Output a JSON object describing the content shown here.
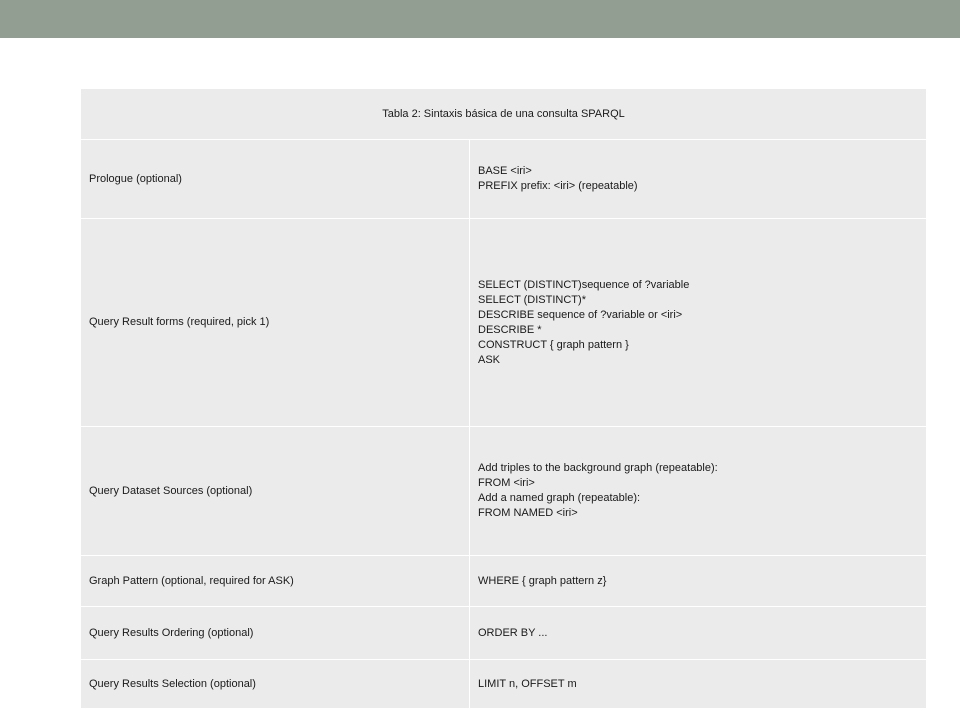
{
  "table": {
    "caption": "Tabla 2: Sintaxis básica de una consulta SPARQL",
    "rows": [
      {
        "label": "Prologue (optional)",
        "lines": [
          "BASE <iri>",
          "PREFIX prefix: <iri> (repeatable)"
        ]
      },
      {
        "label": "Query Result forms (required, pick 1)",
        "lines": [
          "SELECT (DISTINCT)sequence of ?variable",
          "SELECT (DISTINCT)*",
          "DESCRIBE sequence of ?variable or <iri>",
          "DESCRIBE *",
          "CONSTRUCT { graph pattern }",
          "ASK"
        ]
      },
      {
        "label": "Query Dataset Sources (optional)",
        "lines": [
          "Add triples to the background graph (repeatable):",
          "FROM <iri>",
          "Add a named graph (repeatable):",
          "FROM NAMED <iri>"
        ]
      },
      {
        "label": "Graph Pattern (optional, required for ASK)",
        "lines": [
          "WHERE { graph pattern z}"
        ]
      },
      {
        "label": "Query Results Ordering (optional)",
        "lines": [
          "ORDER BY ..."
        ]
      },
      {
        "label": "Query Results Selection (optional)",
        "lines": [
          "LIMIT n, OFFSET m"
        ]
      }
    ]
  }
}
